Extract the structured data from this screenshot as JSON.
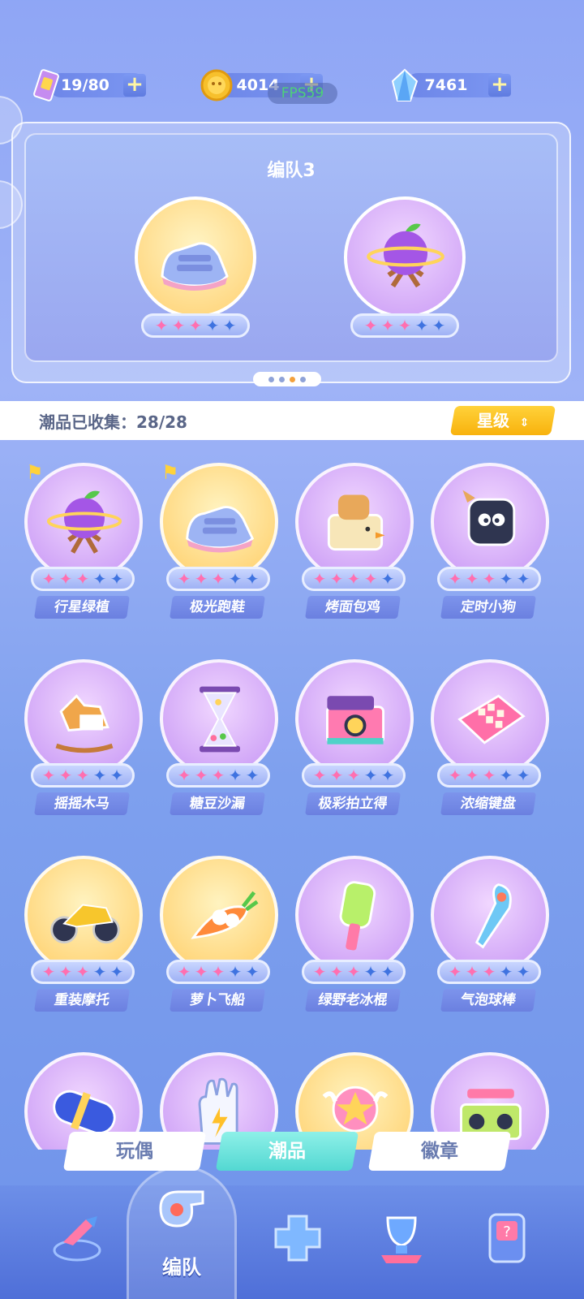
{
  "currency": {
    "tickets": {
      "value": "19/80",
      "icon": "ticket-icon"
    },
    "coins": {
      "value": "4014",
      "icon": "coin-icon"
    },
    "gems": {
      "value": "7461",
      "icon": "crystal-icon"
    },
    "plus": "+"
  },
  "fps": "FPS59",
  "formation": {
    "title": "编队3",
    "items": [
      {
        "name": "极光跑鞋",
        "stars_on": 3,
        "stars_total": 5,
        "bg": "yellow",
        "icon": "sneaker-icon"
      },
      {
        "name": "行星绿植",
        "stars_on": 3,
        "stars_total": 5,
        "bg": "purple",
        "icon": "planet-plant-icon"
      }
    ],
    "pages": 4,
    "active_page": 3
  },
  "collection": {
    "label": "潮品已收集：28/28",
    "sort_label": "星级",
    "sort_icon": "sort-arrows-icon"
  },
  "items": [
    {
      "name": "行星绿植",
      "stars_on": 3,
      "bg": "purple",
      "icon": "planet-plant-icon",
      "flag": true
    },
    {
      "name": "极光跑鞋",
      "stars_on": 3,
      "bg": "yellow",
      "icon": "sneaker-icon",
      "flag": true
    },
    {
      "name": "烤面包鸡",
      "stars_on": 4,
      "bg": "purple",
      "icon": "toaster-chick-icon",
      "flag": false
    },
    {
      "name": "定时小狗",
      "stars_on": 3,
      "bg": "purple",
      "icon": "timer-dog-icon",
      "flag": false
    },
    {
      "name": "摇摇木马",
      "stars_on": 3,
      "bg": "purple",
      "icon": "rocking-horse-icon",
      "flag": false
    },
    {
      "name": "糖豆沙漏",
      "stars_on": 3,
      "bg": "purple",
      "icon": "hourglass-icon",
      "flag": false
    },
    {
      "name": "极彩拍立得",
      "stars_on": 3,
      "bg": "purple",
      "icon": "instant-camera-icon",
      "flag": false
    },
    {
      "name": "浓缩键盘",
      "stars_on": 3,
      "bg": "purple",
      "icon": "keyboard-icon",
      "flag": false
    },
    {
      "name": "重装摩托",
      "stars_on": 3,
      "bg": "yellow",
      "icon": "motorcycle-icon",
      "flag": false
    },
    {
      "name": "萝卜飞船",
      "stars_on": 3,
      "bg": "yellow",
      "icon": "carrot-ship-icon",
      "flag": false
    },
    {
      "name": "绿野老冰棍",
      "stars_on": 3,
      "bg": "purple",
      "icon": "popsicle-icon",
      "flag": false
    },
    {
      "name": "气泡球棒",
      "stars_on": 3,
      "bg": "purple",
      "icon": "bubble-bat-icon",
      "flag": false
    },
    {
      "name": "",
      "stars_on": 0,
      "bg": "purple",
      "icon": "capsule-icon",
      "flag": false
    },
    {
      "name": "",
      "stars_on": 0,
      "bg": "purple",
      "icon": "glove-icon",
      "flag": false
    },
    {
      "name": "",
      "stars_on": 0,
      "bg": "yellow",
      "icon": "star-wand-icon",
      "flag": false
    },
    {
      "name": "",
      "stars_on": 0,
      "bg": "purple",
      "icon": "boombox-icon",
      "flag": false
    }
  ],
  "tabs": [
    {
      "label": "玩偶",
      "active": false
    },
    {
      "label": "潮品",
      "active": true
    },
    {
      "label": "徽章",
      "active": false
    }
  ],
  "bottom_nav": [
    {
      "label": "",
      "icon": "arrow-bolt-icon"
    },
    {
      "label": "编队",
      "icon": "whistle-icon",
      "active": true
    },
    {
      "label": "",
      "icon": "gamepad-icon"
    },
    {
      "label": "",
      "icon": "trophy-icon"
    },
    {
      "label": "",
      "icon": "mystery-machine-icon"
    }
  ],
  "colors": {
    "star_on": "#ff6fb0",
    "star_off": "#3f73e0",
    "accent_yellow": "#f8b20d",
    "active_tab": "#53d8d2"
  }
}
